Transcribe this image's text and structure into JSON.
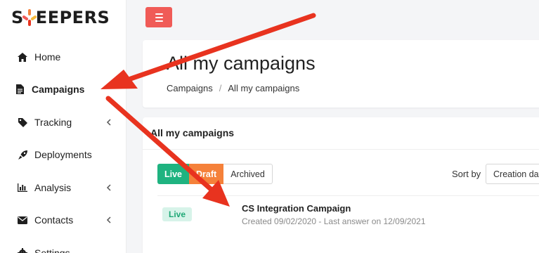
{
  "brand": {
    "logo_pre": "S",
    "logo_post": "EEPERS",
    "accent": "#f05b57"
  },
  "sidebar": {
    "items": [
      {
        "label": "Home",
        "icon": "home-icon"
      },
      {
        "label": "Campaigns",
        "icon": "document-icon"
      },
      {
        "label": "Tracking",
        "icon": "tag-icon"
      },
      {
        "label": "Deployments",
        "icon": "rocket-icon"
      },
      {
        "label": "Analysis",
        "icon": "bar-chart-icon"
      },
      {
        "label": "Contacts",
        "icon": "envelope-icon"
      },
      {
        "label": "Settings",
        "icon": "gear-icon"
      }
    ]
  },
  "header": {
    "title": "All my campaigns",
    "breadcrumb": [
      "Campaigns",
      "All my campaigns"
    ]
  },
  "campaigns": {
    "heading": "All my campaigns",
    "filters": {
      "live": "Live",
      "draft": "Draft",
      "archived": "Archived"
    },
    "sort_label": "Sort by",
    "sort_value": "Creation date",
    "rows": [
      {
        "status": "Live",
        "name": "CS Integration Campaign",
        "meta": "Created 09/02/2020 - Last answer on 12/09/2021"
      }
    ]
  },
  "colors": {
    "live": "#1fb380",
    "draft": "#f5813a",
    "annotation": "#e8331f"
  }
}
